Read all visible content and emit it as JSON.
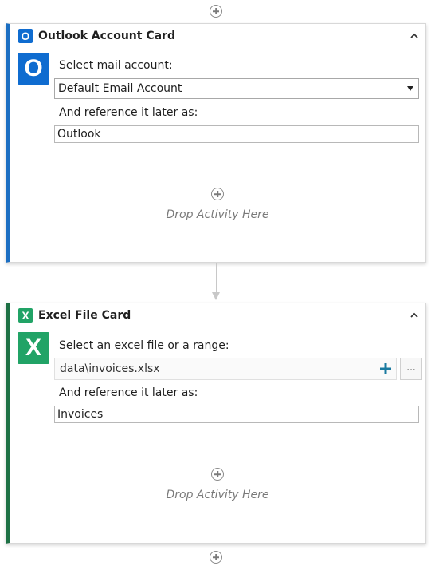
{
  "colors": {
    "outlook_accent": "#1b6ec2",
    "excel_accent": "#1d7044",
    "outlook_icon": "#0f6cd0",
    "excel_icon": "#21a366"
  },
  "cards": [
    {
      "icon": "outlook-icon",
      "badge_letter": "O",
      "title": "Outlook Account Card",
      "field1_label": "Select mail account:",
      "field1_value": "Default Email Account",
      "field2_label": "And reference it later as:",
      "field2_value": "Outlook",
      "drop_text": "Drop Activity Here"
    },
    {
      "icon": "excel-icon",
      "badge_letter": "X",
      "title": "Excel File Card",
      "field1_label": "Select an excel file or a range:",
      "field1_value": "data\\invoices.xlsx",
      "ellipsis_label": "...",
      "field2_label": "And reference it later as:",
      "field2_value": "Invoices",
      "drop_text": "Drop Activity Here"
    }
  ]
}
